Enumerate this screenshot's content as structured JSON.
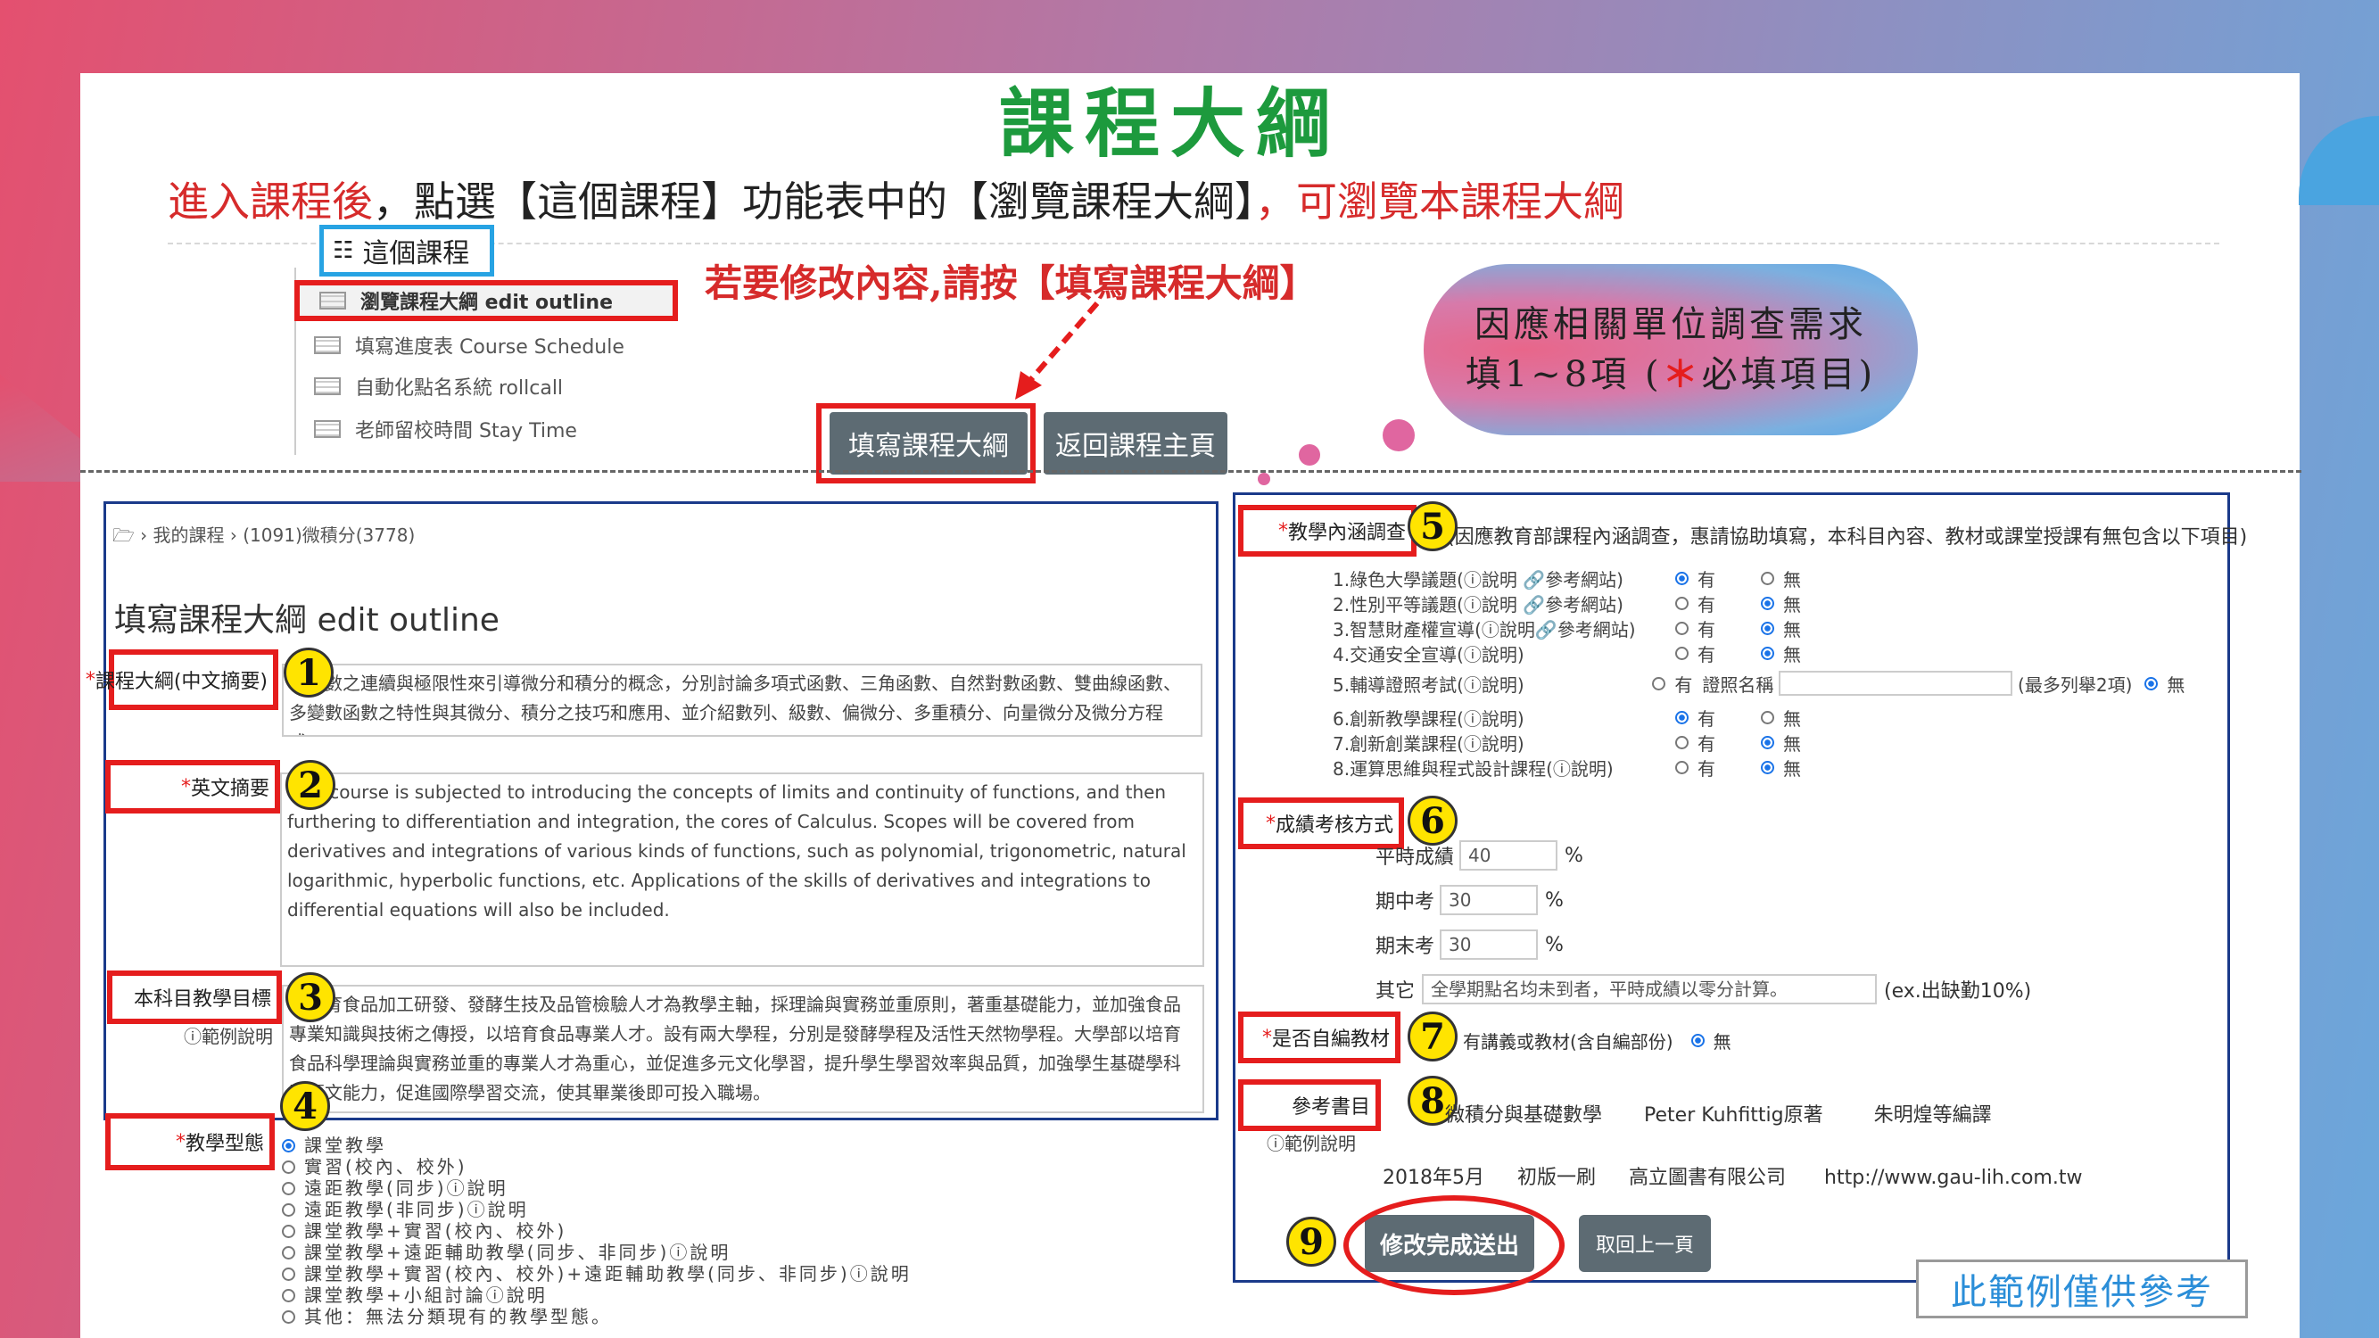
{
  "title": "課程大綱",
  "intro": {
    "part1": "進入課程後",
    "part2": "，點選【這個課程】功能表中的【瀏覽課程大綱】",
    "part3": "，可瀏覽本課程大綱"
  },
  "course_menu": {
    "header": "這個課程",
    "items": [
      {
        "label": "瀏覽課程大綱 edit outline"
      },
      {
        "label": "填寫進度表 Course Schedule"
      },
      {
        "label": "自動化點名系統 rollcall"
      },
      {
        "label": "老師留校時間 Stay Time"
      }
    ]
  },
  "edit_hint": "若要修改內容,請按【填寫課程大綱】",
  "top_buttons": {
    "fill": "填寫課程大綱",
    "back": "返回課程主頁"
  },
  "cloud": {
    "line1": "因應相關單位調查需求",
    "line2_pre": "填1~8項 (",
    "star": "＊",
    "line2_post": "必填項目)"
  },
  "breadcrumb": {
    "home_icon": "folder-icon",
    "sep": "›",
    "my_courses": "我的課程",
    "course": "(1091)微積分(3778)"
  },
  "page_heading": "填寫課程大綱 edit outline",
  "fields": {
    "f1": {
      "req": "*",
      "label": "課程大綱(中文摘要)",
      "text": "從函數之連續與極限性來引導微分和積分的概念，分別討論多項式函數、三角函數、自然對數函數、雙曲線函數、多變數函數之特性與其微分、積分之技巧和應用、並介紹數列、級數、偏微分、多重積分、向量微分及微分方程式。"
    },
    "f2": {
      "req": "*",
      "label": "英文摘要",
      "text": "This course is subjected to introducing the concepts of limits and continuity of functions, and then furthering to differentiation and integration, the cores of Calculus. Scopes will be covered from derivatives and integrations of various kinds of functions, such as polynomial, trigonometric, natural logarithmic, hyperbolic functions, etc. Applications of the skills of derivatives and integrations to differential equations will also be included."
    },
    "f3": {
      "label": "本科目教學目標",
      "note": "ⓘ範例說明",
      "text": "以培育食品加工研發、發酵生技及品管檢驗人才為教學主軸，採理論與實務並重原則，著重基礎能力，並加強食品專業知識與技術之傳授，以培育食品專業人才。設有兩大學程，分別是發酵學程及活性天然物學程。大學部以培育食品科學理論與實務並重的專業人才為重心，並促進多元文化學習，提升學生學習效率與品質，加強學生基礎學科及語文能力，促進國際學習交流，使其畢業後即可投入職場。"
    },
    "f4": {
      "req": "*",
      "label": "教學型態"
    }
  },
  "teaching_types": [
    {
      "label": "課堂教學",
      "checked": true
    },
    {
      "label": "實習(校內、校外)",
      "checked": false
    },
    {
      "label": "遠距教學(同步)ⓘ說明",
      "checked": false
    },
    {
      "label": "遠距教學(非同步)ⓘ說明",
      "checked": false
    },
    {
      "label": "課堂教學+實習(校內、校外)",
      "checked": false
    },
    {
      "label": "課堂教學+遠距輔助教學(同步、非同步)ⓘ說明",
      "checked": false
    },
    {
      "label": "課堂教學+實習(校內、校外)+遠距輔助教學(同步、非同步)ⓘ說明",
      "checked": false
    },
    {
      "label": "課堂教學+小組討論ⓘ說明",
      "checked": false
    },
    {
      "label": "其他：無法分類現有的教學型態。",
      "checked": false
    }
  ],
  "survey": {
    "req": "*",
    "label": "教學內涵調查",
    "desc": "(因應教育部課程內涵調查，惠請協助填寫，本科目內容、教材或課堂授課有無包含以下項目)",
    "yes": "有",
    "no": "無",
    "items": [
      {
        "label": "1.綠色大學議題(ⓘ說明 🔗參考網站)",
        "yes": true
      },
      {
        "label": "2.性別平等議題(ⓘ說明 🔗參考網站)",
        "yes": false
      },
      {
        "label": "3.智慧財產權宣導(ⓘ說明🔗參考網站)",
        "yes": false
      },
      {
        "label": "4.交通安全宣導(ⓘ說明)",
        "yes": false
      },
      {
        "label": "5.輔導證照考試(ⓘ說明)",
        "yes": false,
        "extra_label": "證照名稱",
        "extra_note": "(最多列舉2項)"
      },
      {
        "label": "6.創新教學課程(ⓘ說明)",
        "yes": true
      },
      {
        "label": "7.創新創業課程(ⓘ說明)",
        "yes": false
      },
      {
        "label": "8.運算思維與程式設計課程(ⓘ說明)",
        "yes": false
      }
    ]
  },
  "grading": {
    "req": "*",
    "label": "成績考核方式",
    "regular": {
      "label": "平時成績",
      "value": "40"
    },
    "midterm": {
      "label": "期中考",
      "value": "30"
    },
    "final": {
      "label": "期末考",
      "value": "30"
    },
    "pct": "%",
    "other": {
      "label": "其它",
      "value": "全學期點名均未到者，平時成績以零分計算。",
      "note": "(ex.出缺勤10%)"
    }
  },
  "self_material": {
    "req": "*",
    "label": "是否自編教材",
    "yes_text": "有講義或教材(含自編部份)",
    "no_text": "無"
  },
  "references": {
    "label": "參考書目",
    "note": "ⓘ範例說明",
    "line1": [
      "微積分與基礎數學",
      "Peter Kuhfittig原著",
      "朱明煌等編譯"
    ],
    "line2": [
      "2018年5月",
      "初版一刷",
      "高立圖書有限公司",
      "http://www.gau-lih.com.tw"
    ]
  },
  "bottom_buttons": {
    "submit": "修改完成送出",
    "prev": "取回上一頁"
  },
  "step_numbers": [
    "1",
    "2",
    "3",
    "4",
    "5",
    "6",
    "7",
    "8",
    "9"
  ],
  "disclaimer": "此範例僅供參考"
}
